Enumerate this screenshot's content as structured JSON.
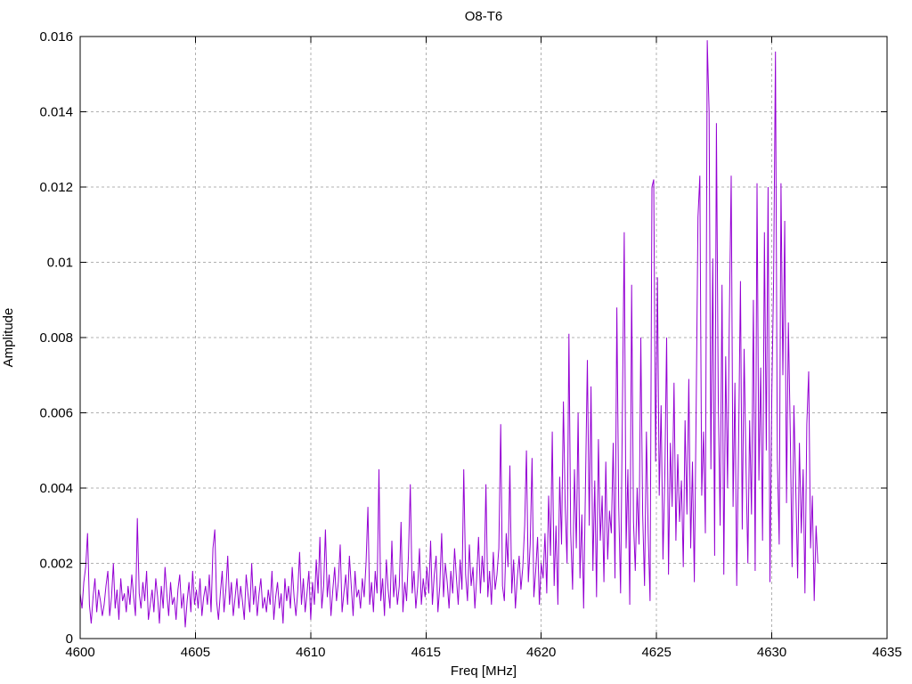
{
  "chart_data": {
    "type": "line",
    "title": "O8-T6",
    "xlabel": "Freq [MHz]",
    "ylabel": "Amplitude",
    "xlim": [
      4600,
      4635
    ],
    "ylim": [
      0,
      0.016
    ],
    "xticks": [
      4600,
      4605,
      4610,
      4615,
      4620,
      4625,
      4630,
      4635
    ],
    "yticks": [
      0,
      0.002,
      0.004,
      0.006,
      0.008,
      0.01,
      0.012,
      0.014,
      0.016
    ],
    "grid": true,
    "legend": "none",
    "line_color": "#9400d3",
    "series": [
      {
        "name": "O8-T6",
        "x_start": 4600,
        "x_step": 0.08,
        "y_scale": 0.0001,
        "y": [
          12,
          8,
          15,
          19,
          28,
          9,
          4,
          11,
          16,
          7,
          13,
          10,
          6,
          9,
          14,
          18,
          6,
          11,
          20,
          8,
          13,
          5,
          16,
          10,
          12,
          7,
          14,
          9,
          17,
          11,
          6,
          32,
          12,
          8,
          15,
          10,
          18,
          5,
          9,
          13,
          7,
          16,
          11,
          4,
          14,
          8,
          19,
          12,
          6,
          15,
          9,
          11,
          5,
          13,
          17,
          8,
          12,
          3,
          10,
          15,
          7,
          18,
          9,
          13,
          8,
          16,
          6,
          11,
          14,
          9,
          17,
          7,
          24,
          29,
          10,
          5,
          12,
          18,
          7,
          13,
          22,
          9,
          15,
          6,
          11,
          16,
          8,
          14,
          10,
          5,
          17,
          12,
          7,
          20,
          9,
          14,
          6,
          12,
          16,
          8,
          11,
          7,
          13,
          9,
          18,
          5,
          11,
          15,
          8,
          12,
          4,
          16,
          10,
          14,
          8,
          19,
          11,
          6,
          13,
          23,
          9,
          16,
          7,
          12,
          18,
          5,
          15,
          9,
          21,
          12,
          27,
          8,
          14,
          29,
          11,
          17,
          6,
          13,
          19,
          10,
          15,
          25,
          7,
          12,
          17,
          9,
          22,
          14,
          6,
          18,
          11,
          13,
          8,
          16,
          11,
          20,
          35,
          9,
          15,
          7,
          18,
          12,
          45,
          10,
          16,
          6,
          21,
          13,
          8,
          26,
          11,
          17,
          9,
          14,
          31,
          7,
          15,
          10,
          22,
          41,
          12,
          18,
          8,
          14,
          24,
          9,
          16,
          11,
          19,
          12,
          26,
          9,
          17,
          22,
          7,
          14,
          28,
          11,
          20,
          15,
          8,
          18,
          12,
          24,
          16,
          9,
          21,
          13,
          45,
          17,
          10,
          25,
          14,
          19,
          8,
          16,
          27,
          12,
          22,
          15,
          41,
          11,
          18,
          9,
          23,
          13,
          17,
          24,
          57,
          14,
          10,
          28,
          19,
          46,
          12,
          21,
          8,
          16,
          22,
          13,
          19,
          30,
          50,
          15,
          25,
          48,
          11,
          18,
          27,
          9,
          20,
          16,
          28,
          12,
          38,
          22,
          55,
          14,
          30,
          9,
          43,
          25,
          63,
          35,
          20,
          81,
          28,
          13,
          45,
          24,
          60,
          16,
          33,
          8,
          41,
          74,
          30,
          67,
          18,
          42,
          11,
          53,
          26,
          38,
          15,
          47,
          21,
          34,
          28,
          52,
          16,
          88,
          35,
          12,
          60,
          108,
          24,
          45,
          9,
          94,
          31,
          18,
          40,
          25,
          80,
          33,
          14,
          55,
          28,
          10,
          120,
          122,
          47,
          96,
          38,
          62,
          21,
          44,
          80,
          17,
          52,
          35,
          68,
          26,
          49,
          31,
          42,
          19,
          58,
          33,
          69,
          24,
          47,
          15,
          62,
          112,
          123,
          38,
          55,
          28,
          159,
          140,
          45,
          101,
          22,
          137,
          63,
          30,
          94,
          17,
          75,
          40,
          85,
          123,
          35,
          68,
          14,
          52,
          95,
          29,
          77,
          46,
          20,
          58,
          33,
          90,
          18,
          121,
          42,
          72,
          26,
          108,
          50,
          120,
          15,
          65,
          95,
          156,
          48,
          25,
          121,
          70,
          111,
          36,
          84,
          55,
          19,
          62,
          40,
          16,
          52,
          28,
          45,
          12,
          57,
          71,
          24,
          38,
          10,
          30,
          20
        ]
      }
    ]
  }
}
